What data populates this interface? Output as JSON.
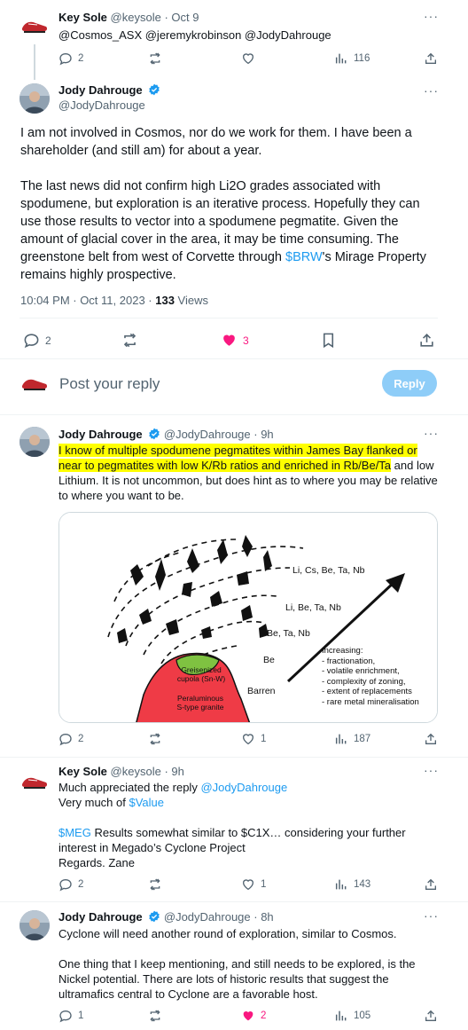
{
  "tweet1": {
    "name": "Key Sole",
    "handle": "@keysole",
    "date": "· Oct 9",
    "mentions": "@Cosmos_ASX @jeremykrobinson @JodyDahrouge",
    "replies": "2",
    "views": "116"
  },
  "main": {
    "name": "Jody Dahrouge",
    "handle": "@JodyDahrouge",
    "para1": "I am not involved in Cosmos, nor do we work for them. I  have been a shareholder (and still am) for about a year.",
    "para2_line1": "The last news did not confirm high Li2O grades associated with",
    "para2_line2": "spodumene, but exploration is an iterative process. Hopefully they can",
    "para2_line3": "use those results to vector into a spodumene pegmatite. Given the",
    "para2_line4": "amount of glacial cover in the area, it may be time consuming.  The",
    "para2_line5a": "greenstone belt from west of Corvette through ",
    "para2_cashtag": "$BRW",
    "para2_line5b": "'s Mirage Property",
    "para2_line6": "remains highly prospective.",
    "timestamp": "10:04 PM · Oct 11, 2023 · ",
    "views": "133",
    "views_label": " Views",
    "replies": "2",
    "likes": "3"
  },
  "composer": {
    "placeholder": "Post your reply",
    "button": "Reply"
  },
  "reply1": {
    "name": "Jody Dahrouge",
    "handle": "@JodyDahrouge",
    "date": "· 9h",
    "line1": "I know of multiple spodumene pegmatites within James Bay flanked or",
    "line2a": "near to pegmatites with low K/Rb ratios and enriched in Rb/Be/Ta",
    "line2b": " and low",
    "line3": "Lithium. It is not uncommon, but does hint as to where you may be relative",
    "line4": "to where you want to be.",
    "replies": "2",
    "likes": "1",
    "views": "187",
    "figure": {
      "zones": [
        "Li, Cs, Be, Ta, Nb",
        "Li, Be, Ta, Nb",
        "Be, Ta, Nb",
        "Be",
        "Barren"
      ],
      "greisen": [
        "Greisenized",
        "cupola (Sn-W)"
      ],
      "granite": [
        "Peraluminous",
        "S-type granite"
      ],
      "increasing_title": "Increasing:",
      "increasing": [
        "- fractionation,",
        "- volatile enrichment,",
        "- complexity of zoning,",
        "- extent of replacements",
        "- rare metal mineralisation"
      ]
    }
  },
  "reply2": {
    "name": "Key Sole",
    "handle": "@keysole",
    "date": "· 9h",
    "line1a": "Much appreciated the reply ",
    "line1_mention": "@JodyDahrouge",
    "line2a": "Very much of ",
    "line2_cashtag": "$Value",
    "line3_cashtag": "$MEG",
    "line3b": " Results somewhat similar to $C1X… considering your further",
    "line4": "interest in Megado’s Cyclone Project",
    "line5": "Regards. Zane",
    "replies": "2",
    "likes": "1",
    "views": "143"
  },
  "reply3": {
    "name": "Jody Dahrouge",
    "handle": "@JodyDahrouge",
    "date": "· 8h",
    "line1": "Cyclone will need another round of exploration, similar to Cosmos.",
    "line2": "One thing that I keep mentioning, and still needs to be explored, is the",
    "line3": "Nickel potential.  There are lots of historic results that suggest the",
    "line4": "ultramafics central to Cyclone are a favorable host.",
    "replies": "1",
    "likes": "2",
    "views": "105"
  },
  "colors": {
    "accent": "#1d9bf0",
    "like_active": "#f91880",
    "highlight": "#ffff00",
    "granite": "#ef3b46",
    "greisen": "#7fc241"
  },
  "icons": [
    "reply-icon",
    "retweet-icon",
    "like-icon",
    "views-icon",
    "bookmark-icon",
    "share-icon",
    "verified-icon",
    "more-icon"
  ]
}
